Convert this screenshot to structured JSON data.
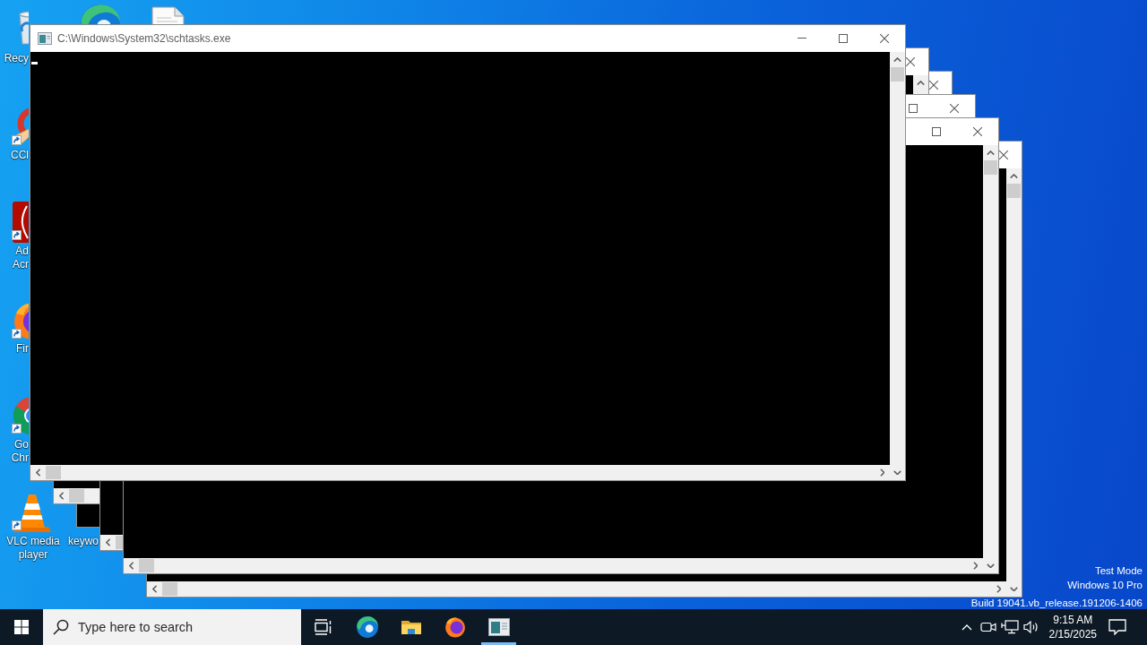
{
  "desktop_icons": [
    {
      "kind": "recycle_bin",
      "label_lines": [
        "Recy"
      ],
      "shortcut": false
    },
    {
      "kind": "wave_logo"
    },
    {
      "kind": "document"
    },
    {
      "kind": "brush_logo",
      "label_lines": [
        "CCl"
      ],
      "shortcut": true
    },
    {
      "kind": "tile_logo",
      "label_lines": [
        "Ad",
        "Acr"
      ],
      "shortcut": true
    },
    {
      "kind": "fox_logo",
      "label_lines": [
        "Fir"
      ],
      "shortcut": true
    },
    {
      "kind": "circle_logo",
      "label_lines": [
        "Go",
        "Chr"
      ],
      "shortcut": true
    },
    {
      "kind": "traffic_cone",
      "label_lines": [
        "VLC media",
        "player"
      ],
      "shortcut": true
    },
    {
      "label_lines": [
        "keywo"
      ]
    }
  ],
  "windows": [
    {
      "title": "C:\\Windows\\System32\\schtasks.exe",
      "cursor": true,
      "buttons": [
        {
          "kind": "minimize"
        },
        {
          "kind": "maximize"
        },
        {
          "kind": "close"
        }
      ],
      "scroll_parts": [
        {
          "kind": "up_arrow"
        },
        {
          "kind": "vertical_thumb"
        },
        {
          "kind": "down_arrow"
        },
        {
          "kind": "left_arrow"
        },
        {
          "kind": "horizontal_thumb"
        },
        {
          "kind": "right_arrow"
        }
      ]
    },
    {
      "buttons": [
        {
          "kind": "close"
        }
      ],
      "scroll_parts": [
        {
          "kind": "up_arrow"
        },
        {
          "kind": "left_arrow"
        },
        {
          "kind": "horizontal_thumb"
        }
      ]
    },
    {
      "buttons": [
        {
          "kind": "close"
        }
      ]
    },
    {
      "buttons": [
        {
          "kind": "maximize"
        },
        {
          "kind": "close"
        }
      ],
      "scroll_parts": [
        {
          "kind": "left_arrow"
        },
        {
          "kind": "horizontal_thumb"
        }
      ]
    },
    {
      "buttons": [
        {
          "kind": "maximize"
        },
        {
          "kind": "close"
        }
      ],
      "scroll_parts": [
        {
          "kind": "up_arrow"
        },
        {
          "kind": "vertical_thumb"
        },
        {
          "kind": "down_arrow"
        },
        {
          "kind": "left_arrow"
        },
        {
          "kind": "horizontal_thumb"
        },
        {
          "kind": "right_arrow"
        }
      ]
    },
    {
      "buttons": [
        {
          "kind": "close"
        }
      ],
      "scroll_parts": [
        {
          "kind": "up_arrow"
        },
        {
          "kind": "vertical_thumb"
        },
        {
          "kind": "down_arrow"
        },
        {
          "kind": "left_arrow"
        },
        {
          "kind": "horizontal_thumb"
        },
        {
          "kind": "right_arrow"
        }
      ]
    }
  ],
  "system_info": [
    "Test Mode",
    "Windows 10 Pro",
    "Build 19041.vb_release.191206-1406"
  ],
  "taskbar": {
    "search": {
      "placeholder": "Type here to search"
    },
    "apps": [
      {
        "kind": "task_view",
        "running": false
      },
      {
        "kind": "wave_logo",
        "running": false
      },
      {
        "kind": "folder",
        "running": false
      },
      {
        "kind": "fox_logo",
        "running": false
      },
      {
        "kind": "console",
        "running": true
      }
    ],
    "clock": {
      "time": "9:15 AM",
      "date": "2/15/2025"
    }
  }
}
